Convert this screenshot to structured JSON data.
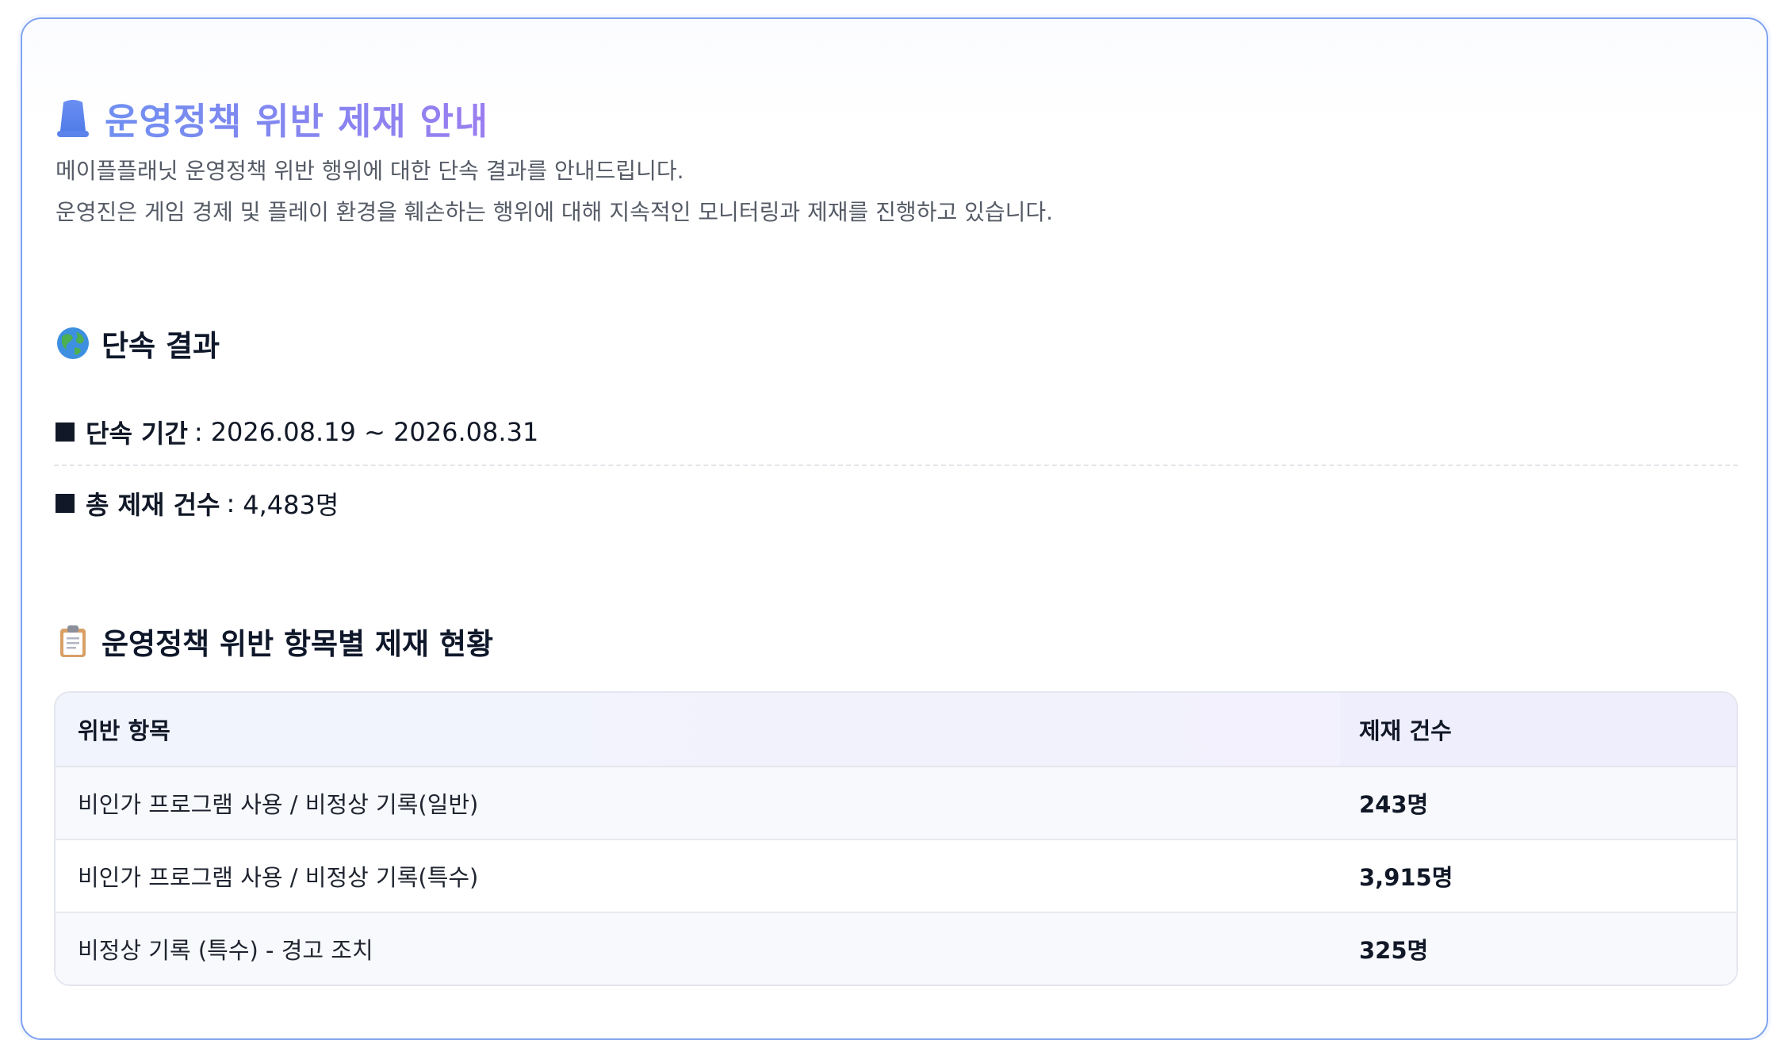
{
  "notice": {
    "title": "운영정책 위반 제재 안내",
    "icon": "bell-icon",
    "accent_colors": [
      "#6f8ff0",
      "#9a7ef0"
    ],
    "desc_line1": "메이플플래닛 운영정책 위반 행위에 대한 단속 결과를 안내드립니다.",
    "desc_line2": "운영진은 게임 경제 및 플레이 환경을 훼손하는 행위에 대해 지속적인 모니터링과 제재를 진행하고 있습니다."
  },
  "results": {
    "heading": "단속 결과",
    "icon": "globe-icon",
    "period_label": "단속 기간",
    "period_value": "2026.08.19 ~ 2026.08.31",
    "total_label": "총 제재 건수",
    "total_value": "4,483명"
  },
  "breakdown": {
    "heading": "운영정책 위반 항목별 제재 현황",
    "icon": "clipboard-icon",
    "columns": [
      "위반 항목",
      "제재 건수"
    ],
    "rows": [
      {
        "item": "비인가 프로그램 사용 / 비정상 기록(일반)",
        "count": "243명"
      },
      {
        "item": "비인가 프로그램 사용 / 비정상 기록(특수)",
        "count": "3,915명"
      },
      {
        "item": "비정상 기록 (특수) - 경고 조치",
        "count": "325명"
      }
    ]
  }
}
